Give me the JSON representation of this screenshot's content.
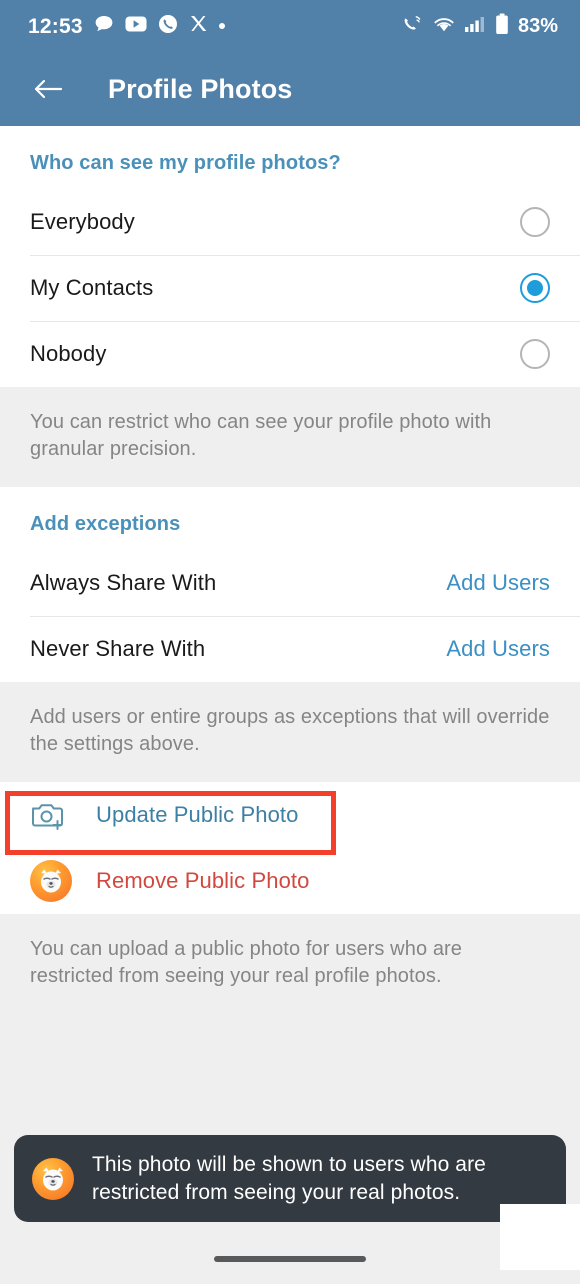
{
  "status_bar": {
    "time": "12:53",
    "battery_percent": "83%",
    "left_icons": [
      "message-bubble-icon",
      "youtube-icon",
      "phone-circle-icon",
      "x-twitter-icon",
      "dot-icon"
    ],
    "right_icons": [
      "call-signal-icon",
      "wifi-icon",
      "cellular-signal-icon",
      "battery-icon"
    ]
  },
  "app_bar": {
    "back_icon": "back-arrow-icon",
    "title": "Profile Photos"
  },
  "visibility_section": {
    "header": "Who can see my profile photos?",
    "options": [
      {
        "label": "Everybody",
        "selected": false
      },
      {
        "label": "My Contacts",
        "selected": true
      },
      {
        "label": "Nobody",
        "selected": false
      }
    ],
    "footer": "You can restrict who can see your profile photo with granular precision."
  },
  "exceptions_section": {
    "header": "Add exceptions",
    "rows": [
      {
        "label": "Always Share With",
        "action": "Add Users"
      },
      {
        "label": "Never Share With",
        "action": "Add Users"
      }
    ],
    "footer": "Add users or entire groups as exceptions that will override the settings above."
  },
  "public_photo_section": {
    "update_label": "Update Public Photo",
    "update_icon": "camera-add-icon",
    "remove_label": "Remove Public Photo",
    "remove_icon": "profile-avatar-icon",
    "footer": "You can upload a public photo for users who are restricted from seeing your real profile photos."
  },
  "toast": {
    "avatar_icon": "profile-avatar-icon",
    "message": "This photo will be shown to users who are restricted from seeing your real photos."
  },
  "nav_bar": {
    "home_indicator": "home-indicator"
  },
  "colors": {
    "app_bar": "#5180a8",
    "accent_blue": "#3a8fc4",
    "section_header_blue": "#4a90b9",
    "radio_selected": "#1e9cdb",
    "remove_red": "#d2483f",
    "highlight_red": "#f4402b",
    "toast_bg": "#333a41",
    "page_bg": "#efefef"
  }
}
